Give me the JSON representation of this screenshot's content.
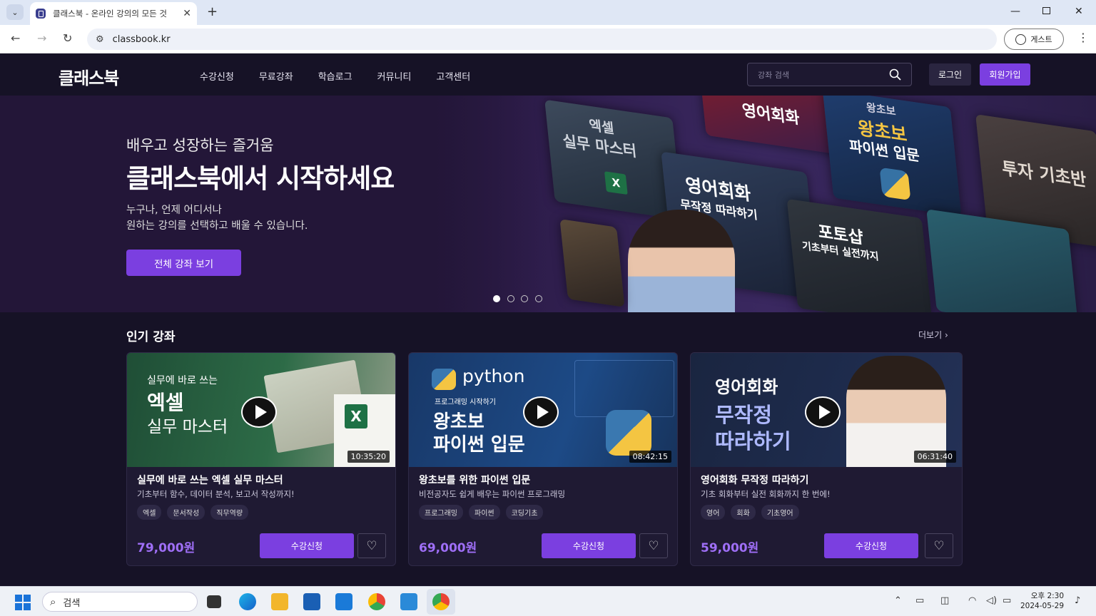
{
  "browser": {
    "tab_title": "클래스북 - 온라인 강의의 모든 것",
    "tab_close": "✕",
    "new_tab": "+",
    "url": "classbook.kr",
    "guest_label": "게스트",
    "menu": "⋮"
  },
  "header": {
    "logo": "클래스북",
    "nav": [
      "수강신청",
      "무료강좌",
      "학습로그",
      "커뮤니티",
      "고객센터"
    ],
    "search_placeholder": "강좌 검색",
    "login": "로그인",
    "signup": "회원가입"
  },
  "hero": {
    "subtitle": "배우고 성장하는 즐거움",
    "title": "클래스북에서 시작하세요",
    "desc1": "누구나, 언제 어디서나",
    "desc2": "원하는 강의를 선택하고 배울 수 있습니다.",
    "button": "전체 강좌 보기",
    "slides_total": 4,
    "active_slide": 1,
    "posters": [
      {
        "l1": "엑셀",
        "l2": "실무 마스터"
      },
      {
        "l1": "영어회화"
      },
      {
        "l1": "왕초보",
        "l2": "왕초보",
        "l3": "파이썬 입문"
      },
      {
        "l1": "영어회화",
        "l2": "무작정 따라하기"
      },
      {
        "l1": "투자 기초반",
        "l2": "투자 기초반"
      },
      {
        "l1": "포토샵",
        "l2": "기초부터 실전까지"
      }
    ]
  },
  "popular": {
    "title": "인기 강좌",
    "more": "더보기",
    "courses": [
      {
        "thumb_small": "실무에 바로 쓰는",
        "thumb_big1": "엑셀",
        "thumb_big2": "실무 마스터",
        "duration": "10:35:20",
        "title": "실무에 바로 쓰는 엑셀 실무 마스터",
        "desc": "기초부터 함수, 데이터 분석, 보고서 작성까지!",
        "tags": [
          "엑셀",
          "문서작성",
          "직무역량"
        ],
        "price": "79,000원",
        "enroll": "수강신청"
      },
      {
        "thumb_brand": "python",
        "thumb_small": "프로그래밍 시작하기",
        "thumb_big1": "왕초보",
        "thumb_big2": "파이썬 입문",
        "duration": "08:42:15",
        "title": "왕초보를 위한 파이썬 입문",
        "desc": "비전공자도 쉽게 배우는 파이썬 프로그래밍",
        "tags": [
          "프로그래밍",
          "파이썬",
          "코딩기초"
        ],
        "price": "69,000원",
        "enroll": "수강신청"
      },
      {
        "thumb_big1": "영어회화",
        "thumb_big2": "무작정",
        "thumb_big3": "따라하기",
        "duration": "06:31:40",
        "title": "영어회화 무작정 따라하기",
        "desc": "기초 회화부터 실전 회화까지 한 번에!",
        "tags": [
          "영어",
          "회화",
          "기초영어"
        ],
        "price": "59,000원",
        "enroll": "수강신청"
      }
    ]
  },
  "taskbar": {
    "search": "검색",
    "time": "오후 2:30",
    "date": "2024-05-29"
  },
  "colors": {
    "accent": "#7b3fe0",
    "price": "#9f6ff7",
    "bg": "#161226"
  }
}
